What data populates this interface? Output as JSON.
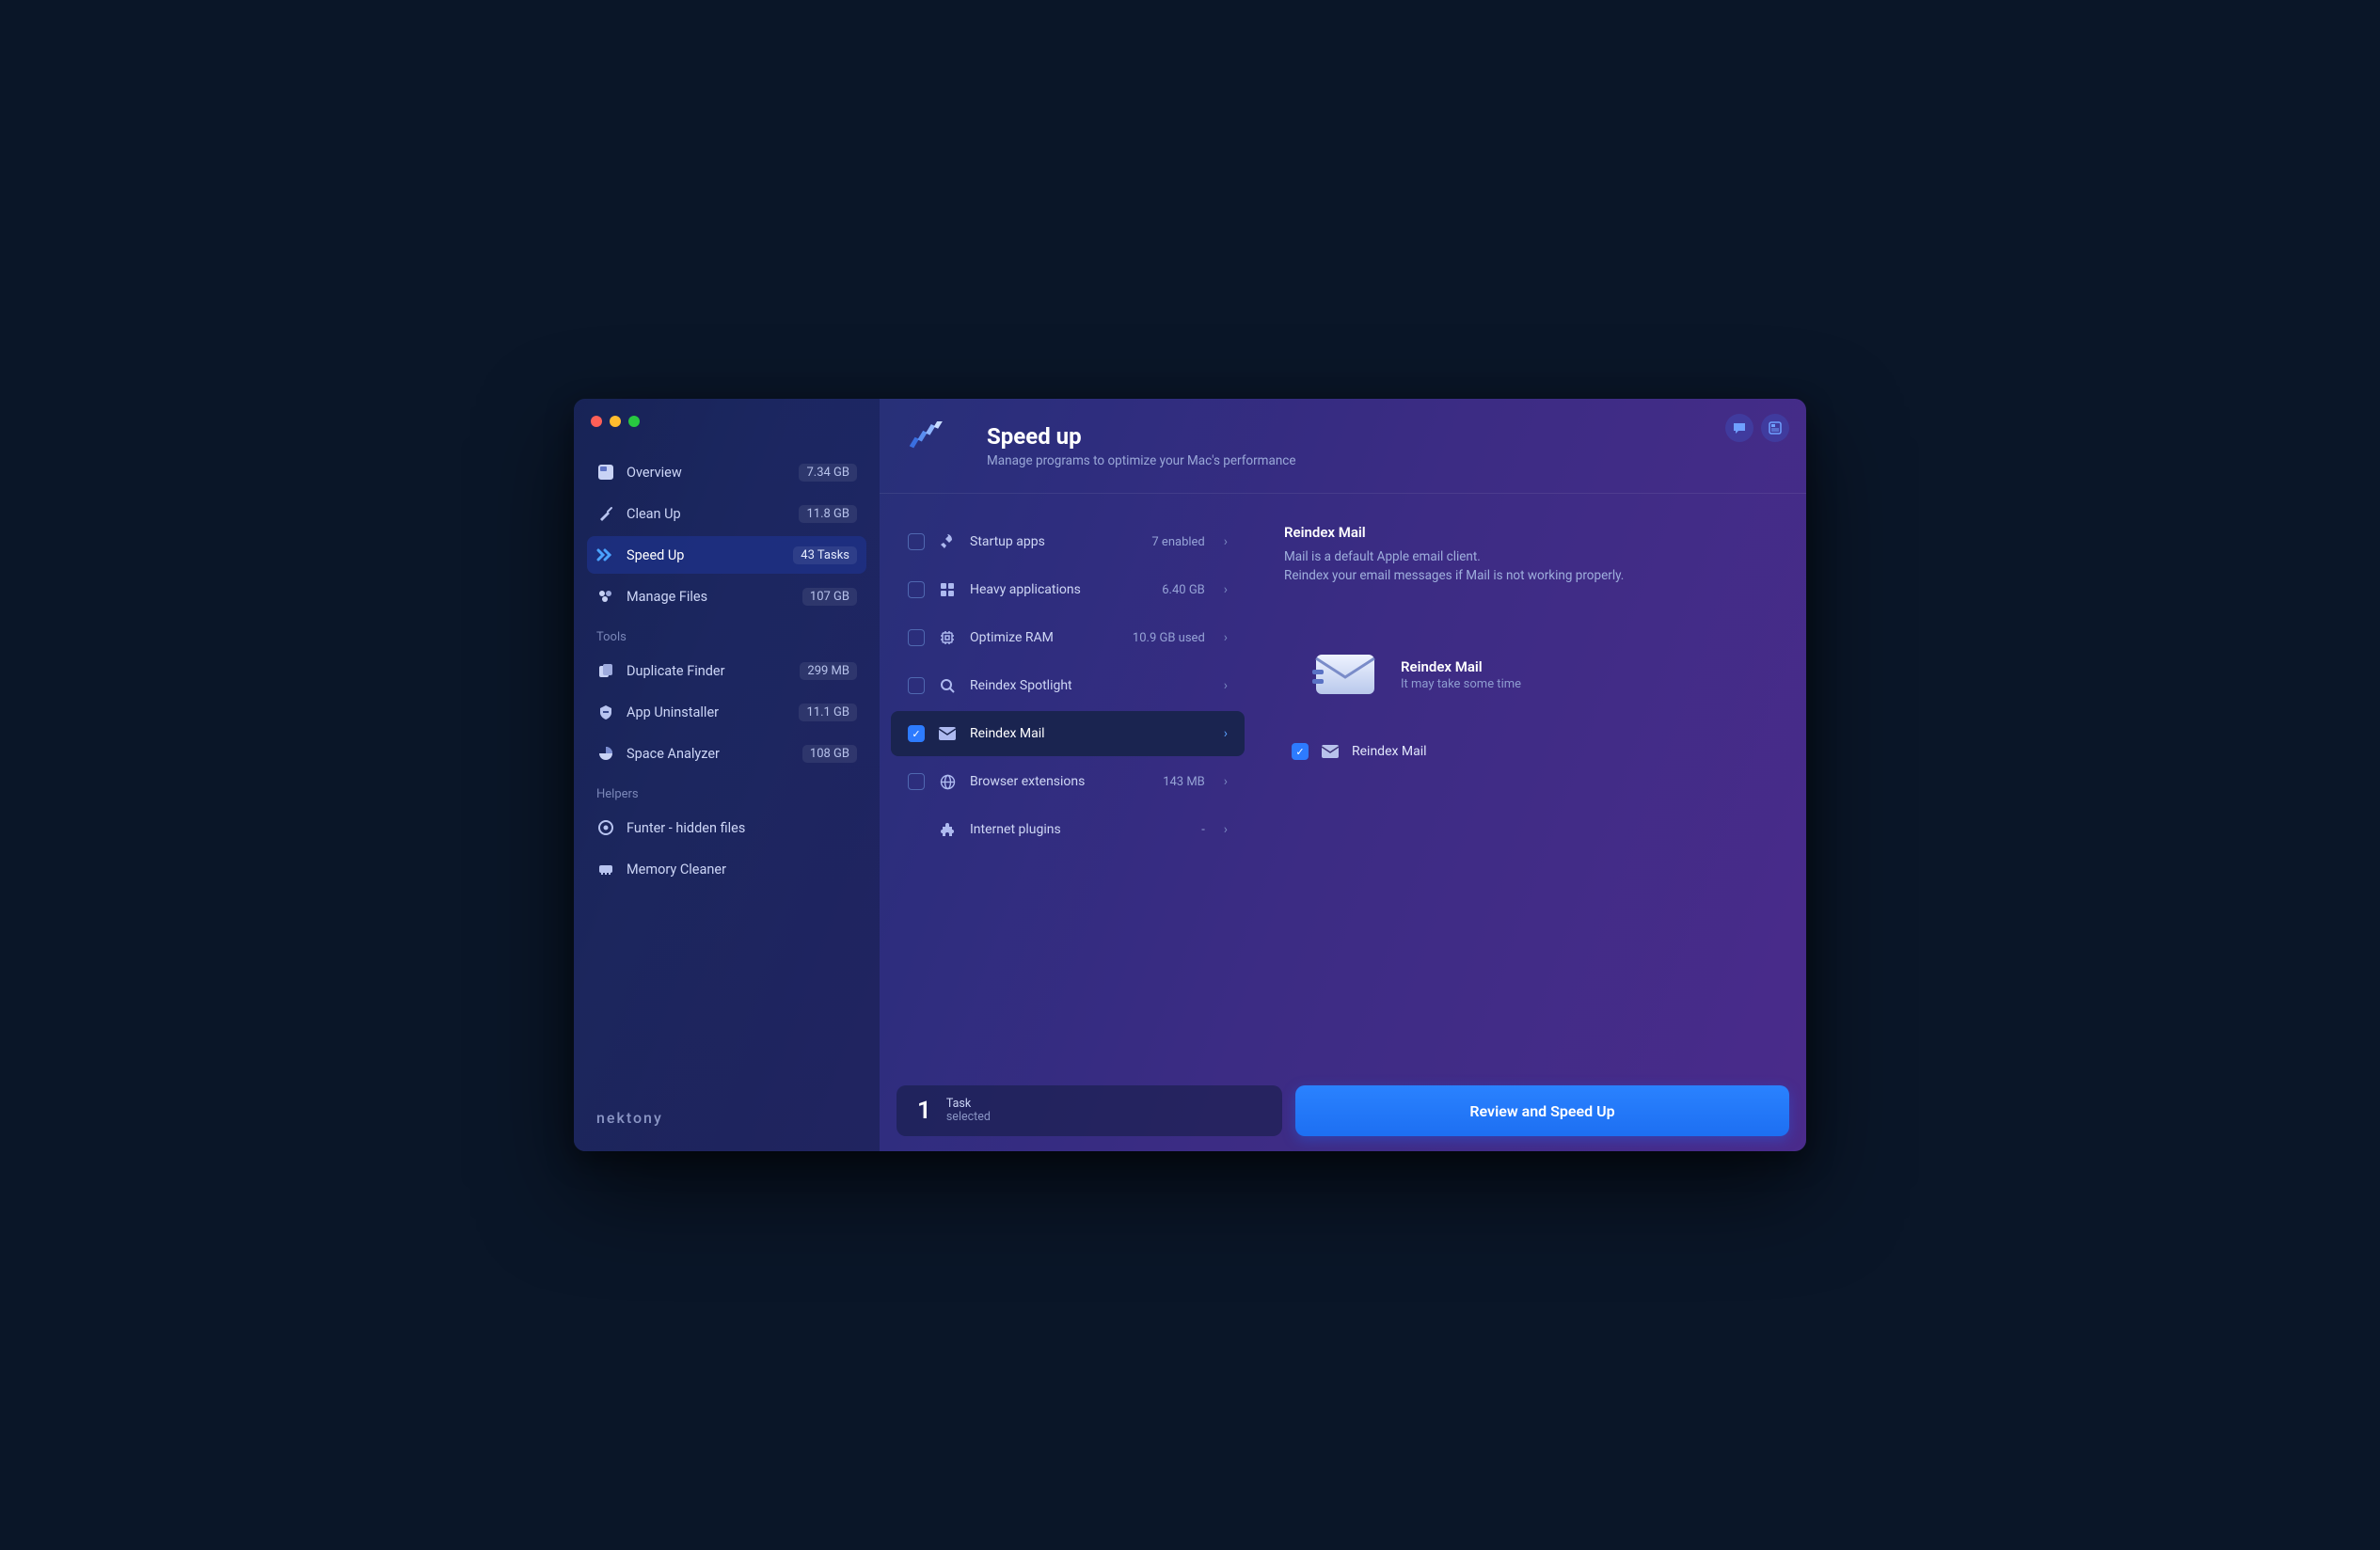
{
  "brand": "nektony",
  "header": {
    "title": "Speed up",
    "subtitle": "Manage programs to optimize your Mac's performance"
  },
  "sidebar": {
    "main": [
      {
        "label": "Overview",
        "badge": "7.34 GB"
      },
      {
        "label": "Clean Up",
        "badge": "11.8 GB"
      },
      {
        "label": "Speed Up",
        "badge": "43 Tasks"
      },
      {
        "label": "Manage Files",
        "badge": "107 GB"
      }
    ],
    "tools_label": "Tools",
    "tools": [
      {
        "label": "Duplicate Finder",
        "badge": "299 MB"
      },
      {
        "label": "App Uninstaller",
        "badge": "11.1 GB"
      },
      {
        "label": "Space Analyzer",
        "badge": "108 GB"
      }
    ],
    "helpers_label": "Helpers",
    "helpers": [
      {
        "label": "Funter - hidden files"
      },
      {
        "label": "Memory Cleaner"
      }
    ]
  },
  "tasks": [
    {
      "label": "Startup apps",
      "value": "7 enabled"
    },
    {
      "label": "Heavy applications",
      "value": "6.40 GB"
    },
    {
      "label": "Optimize RAM",
      "value": "10.9 GB used"
    },
    {
      "label": "Reindex Spotlight",
      "value": ""
    },
    {
      "label": "Reindex Mail",
      "value": ""
    },
    {
      "label": "Browser extensions",
      "value": "143 MB"
    },
    {
      "label": "Internet plugins",
      "value": "-"
    }
  ],
  "detail": {
    "title": "Reindex Mail",
    "description": "Mail is a default Apple email client.\nReindex your email messages if Mail is not working properly.",
    "card_title": "Reindex Mail",
    "card_sub": "It may take some time",
    "option_label": "Reindex Mail"
  },
  "footer": {
    "count": "1",
    "unit": "Task",
    "status": "selected",
    "button": "Review and Speed Up"
  }
}
